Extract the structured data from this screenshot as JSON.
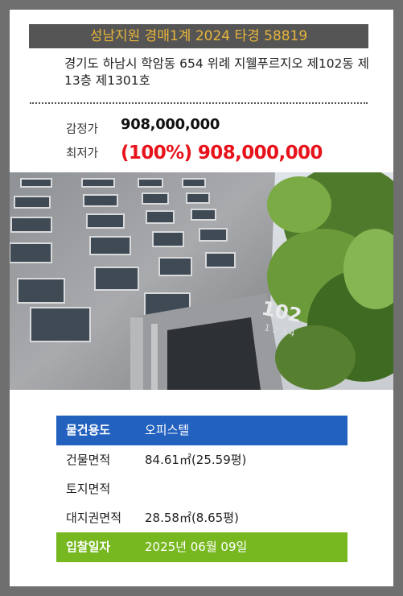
{
  "header": {
    "title": "성남지원 경매1계 2024 타경 58819"
  },
  "address": {
    "text": "경기도 하남시 학암동 654 위례 지웰푸르지오 제102동 제13층 제1301호"
  },
  "prices": {
    "appraisal_label": "감정가",
    "appraisal_value": "908,000,000",
    "minimum_label": "최저가",
    "minimum_value": "(100%) 908,000,000"
  },
  "photo": {
    "building_sign": "102",
    "sign_sub": "1 2 3 4"
  },
  "info": {
    "rows": [
      {
        "label": "물건용도",
        "value": "오피스텔"
      },
      {
        "label": "건물면적",
        "value": "84.61㎡(25.59평)"
      },
      {
        "label": "토지면적",
        "value": ""
      },
      {
        "label": "대지권면적",
        "value": "28.58㎡(8.65평)"
      },
      {
        "label": "입찰일자",
        "value": "2025년 06월 09일"
      }
    ]
  },
  "colors": {
    "header_bg": "#555555",
    "header_text": "#e8b53a",
    "min_price": "#e8121b",
    "usage_row": "#2361bf",
    "date_row": "#77b820"
  }
}
